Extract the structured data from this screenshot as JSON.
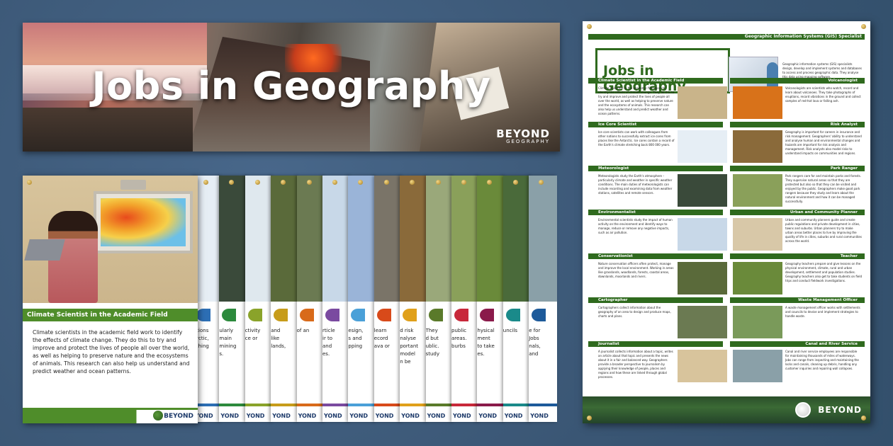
{
  "banner": {
    "title": "Jobs in Geography",
    "brand": "BEYOND",
    "brand_sub": "GEOGRAPHY"
  },
  "main_poster": {
    "heading": "Climate Scientist in the Academic Field",
    "body": "Climate scientists in the academic field work to identify the effects of climate change. They do this to try and improve and protect the lives of people all over the world, as well as helping to preserve nature and the ecosystems of animals. This research can also help us understand and predict weather and ocean patterns.",
    "footer_logo": "BEYOND"
  },
  "strips": [
    {
      "color": "#2d6fb5",
      "img": "#e6eef5",
      "snippet": "ations\narctic,\ntching",
      "logo": "YOND"
    },
    {
      "color": "#2c8a3c",
      "img": "#3a4a3a",
      "snippet": "ularly\nmain\nmining\ns.",
      "logo": "YOND"
    },
    {
      "color": "#8aa32a",
      "img": "#dfe8ee",
      "snippet": "ctivity\nce or",
      "logo": "YOND"
    },
    {
      "color": "#c79c1a",
      "img": "#5a6a3a",
      "snippet": "and\nlike\nlands,",
      "logo": "YOND"
    },
    {
      "color": "#d86a1a",
      "img": "#6b7a52",
      "snippet": "of an",
      "logo": "YOND"
    },
    {
      "color": "#7a4aa0",
      "img": "#c8d8e8",
      "snippet": "rticle\nir to\nand\nes.",
      "logo": "YOND"
    },
    {
      "color": "#4aa0d8",
      "img": "#9ab4d8",
      "snippet": "esign,\ns and\npping",
      "logo": "YOND"
    },
    {
      "color": "#d84a1a",
      "img": "#7a7468",
      "snippet": "learn\necord\nava or",
      "logo": "YOND"
    },
    {
      "color": "#e0a01a",
      "img": "#8a6a3a",
      "snippet": "d risk\nnalyse\nportant\nmodel\nn be",
      "logo": "YOND"
    },
    {
      "color": "#5a7a2a",
      "img": "#9aa87a",
      "snippet": "They\nd but\nublic.\nstudy",
      "logo": "YOND"
    },
    {
      "color": "#c8283a",
      "img": "#8aa05a",
      "snippet": "public\nareas.\nburbs",
      "logo": "YOND"
    },
    {
      "color": "#8a1a4a",
      "img": "#6a8a3a",
      "snippet": "hysical\nment\nto take\nes.",
      "logo": "YOND"
    },
    {
      "color": "#1a8a8a",
      "img": "#4a6a3a",
      "snippet": "uncils",
      "logo": "YOND"
    },
    {
      "color": "#1d5a9a",
      "img": "#8aa0a8",
      "snippet": "e for\nJobs\nnals,\nand",
      "logo": "YOND"
    }
  ],
  "big_poster": {
    "title": "Jobs in Geography",
    "top_label": "Geographic Information Systems (GIS) Specialist",
    "top_text": "Geographic information systems (GIS) specialists design, develop and implement systems and databases to access and process geographic data. They analyse this data using mapping software.",
    "rows": [
      {
        "left": "Climate Scientist in the Academic Field",
        "right": "Volcanologist",
        "ltext": "Climate scientists in the academic field work to identify the effects of climate change. They do this to try and improve and protect the lives of people all over the world, as well as helping to preserve nature and the ecosystems of animals. This research can also help us understand and predict weather and ocean patterns.",
        "rtext": "Volcanologists are scientists who watch, record and learn about volcanoes. They take photographs of eruptions, record vibrations in the ground and collect samples of red-hot lava or falling ash.",
        "limg": "#c9b48a",
        "rimg": "#d8721a"
      },
      {
        "left": "Ice Core Scientist",
        "right": "Risk Analyst",
        "ltext": "Ice core scientists can work with colleagues from other nations to successfully extract ice cores from places like the Antarctic. Ice cores contain a record of the Earth's climate stretching back 800 000 years.",
        "rtext": "Geography is important for careers in insurance and risk management. Geographers' ability to understand and analyse human and environmental changes and hazards are important for risk analysis and management. Risk analysts also model risks to understand impacts on communities and regions.",
        "limg": "#e6eef5",
        "rimg": "#8a6a3a"
      },
      {
        "left": "Meteorologist",
        "right": "Park Ranger",
        "ltext": "Meteorologists study the Earth's atmosphere – particularly climate and weather in specific weather conditions. The main duties of meteorologists can include recording and examining data from weather stations, satellites and remote sensors.",
        "rtext": "Park rangers care for and maintain parks and forests. They supervise natural areas so that they are protected but also so that they can be visited and enjoyed by the public. Geographers make good park rangers because they study and learn about the natural environment and how it can be managed successfully.",
        "limg": "#3a4a3a",
        "rimg": "#8aa05a"
      },
      {
        "left": "Environmentalist",
        "right": "Urban and Community Planner",
        "ltext": "Environmental scientists study the impact of human activity on the environment and identify ways to manage, reduce or remove any negative impacts, such as air pollution.",
        "rtext": "Urban and community planners guide and create public regulations and private development in cities, towns and suburbs. Urban planners try to make urban areas better places to live by improving the quality of life in cities, suburbs and rural communities across the world.",
        "limg": "#c8d8e8",
        "rimg": "#d8c8a8"
      },
      {
        "left": "Conservationist",
        "right": "Teacher",
        "ltext": "Nature conservation officers often protect, manage and improve the local environment. Working in areas like grasslands, woodlands, forests, coastal areas, downlands, moorlands and rivers.",
        "rtext": "Geography teachers prepare and give lessons on the physical environment, climate, rural and urban development, settlement and population studies. Geography teachers also get to take students on field trips and conduct fieldwork investigations.",
        "limg": "#5a6a3a",
        "rimg": "#6a8a3a"
      },
      {
        "left": "Cartographer",
        "right": "Waste Management Officer",
        "ltext": "Cartographers collect information about the geography of an area to design and produce maps, charts and plans.",
        "rtext": "A waste management officer works with settlements and councils to devise and implement strategies to handle waste.",
        "limg": "#6b7a52",
        "rimg": "#7a9a5a"
      },
      {
        "left": "Journalist",
        "right": "Canal and River Service",
        "ltext": "A journalist collects information about a topic, writes an article about that topic and presents the news about it in a fair and balanced way. Geographers provide a broader perspective to journalism by applying their knowledge of people, places and regions and how these are linked through global processes.",
        "rtext": "Canal and river service employees are responsible for maintaining thousands of miles of waterways. Jobs can range from inspecting and maintaining the locks and canals, cleaning up debris, handling any customer inquiries and repairing wall collapses.",
        "limg": "#d8c49c",
        "rimg": "#8aa0a8"
      }
    ],
    "footer_logo": "BEYOND"
  }
}
